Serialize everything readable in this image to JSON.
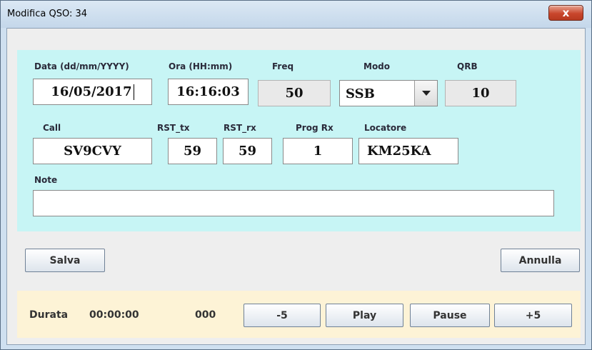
{
  "window": {
    "title": "Modifica QSO: 34",
    "close_label": "x"
  },
  "form": {
    "date": {
      "label": "Data (dd/mm/YYYY)",
      "value": "16/05/2017"
    },
    "time": {
      "label": "Ora (HH:mm)",
      "value": "16:16:03"
    },
    "freq": {
      "label": "Freq",
      "value": "50"
    },
    "mode": {
      "label": "Modo",
      "value": "SSB"
    },
    "qrb": {
      "label": "QRB",
      "value": "10"
    },
    "call": {
      "label": "Call",
      "value": "SV9CVY"
    },
    "rst_tx": {
      "label": "RST_tx",
      "value": "59"
    },
    "rst_rx": {
      "label": "RST_rx",
      "value": "59"
    },
    "prog_rx": {
      "label": "Prog Rx",
      "value": "1"
    },
    "locator": {
      "label": "Locatore",
      "value": "KM25KA"
    },
    "note": {
      "label": "Note",
      "value": ""
    }
  },
  "actions": {
    "save_label": "Salva",
    "cancel_label": "Annulla"
  },
  "timer": {
    "duration_label": "Durata",
    "duration_value": "00:00:00",
    "counter": "000",
    "minus_label": "-5",
    "play_label": "Play",
    "pause_label": "Pause",
    "plus_label": "+5"
  },
  "icons": {
    "close": "close-icon",
    "dropdown": "chevron-down-icon"
  }
}
